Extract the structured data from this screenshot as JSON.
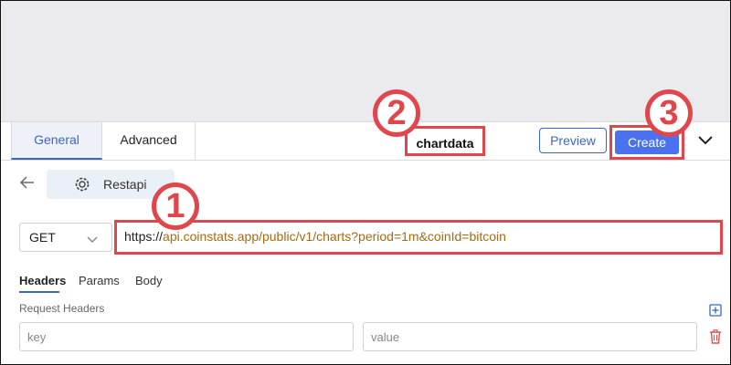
{
  "tabs": {
    "general": "General",
    "advanced": "Advanced"
  },
  "header": {
    "flow_name": "chartdata",
    "preview_label": "Preview",
    "create_label": "Create"
  },
  "app": {
    "name": "Restapi"
  },
  "request": {
    "method": "GET",
    "url_scheme": "https://",
    "url_rest": "api.coinstats.app/public/v1/charts?period=1m&coinId=bitcoin",
    "tabs": {
      "headers": "Headers",
      "params": "Params",
      "body": "Body"
    },
    "section_label": "Request Headers",
    "key_placeholder": "key",
    "value_placeholder": "value"
  },
  "annotations": {
    "one": "1",
    "two": "2",
    "three": "3"
  },
  "colors": {
    "accent": "#3a66c5",
    "create_button": "#4a72f0",
    "highlight": "#e0474c",
    "url_text": "#a66a12",
    "trash": "#d9534f"
  }
}
